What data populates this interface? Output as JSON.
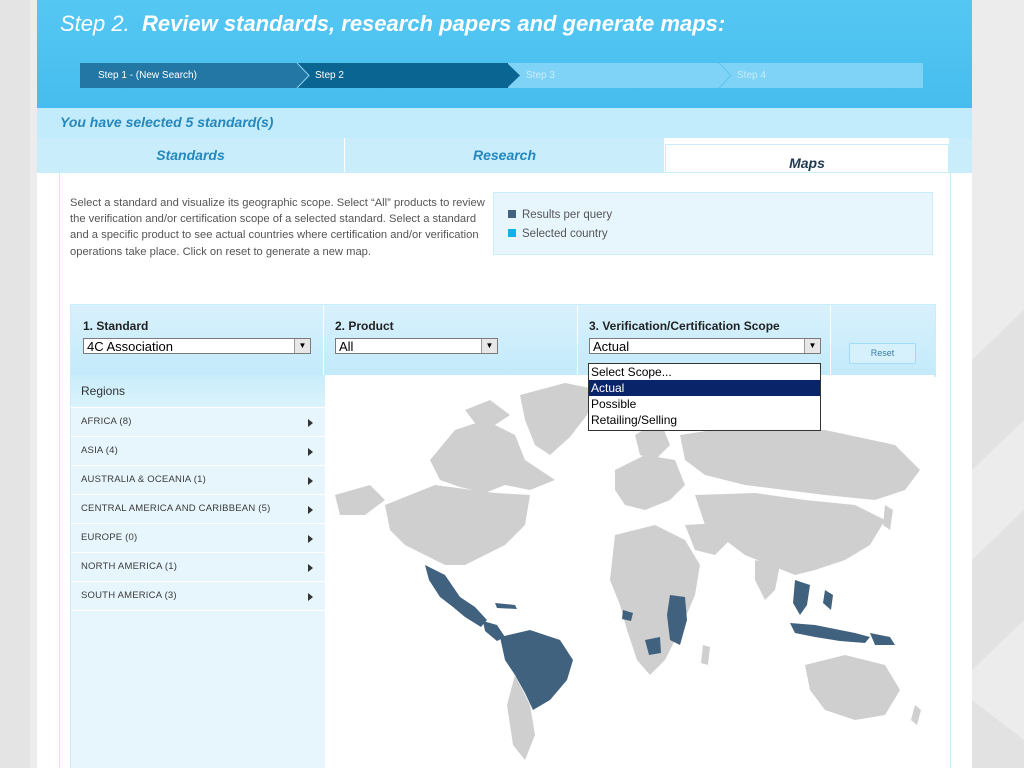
{
  "header": {
    "step_prefix": "Step 2.",
    "title": "Review standards, research papers and generate maps:"
  },
  "steps": [
    {
      "label": "Step 1 - (New Search)"
    },
    {
      "label": "Step 2"
    },
    {
      "label": "Step 3"
    },
    {
      "label": "Step 4"
    }
  ],
  "selected_text": "You have selected 5 standard(s)",
  "tabs": [
    {
      "label": "Standards"
    },
    {
      "label": "Research"
    },
    {
      "label": "Maps"
    }
  ],
  "description": "Select a standard and visualize its geographic scope. Select “All” products to review the verification and/or certification scope of a selected standard. Select a standard and a specific product to see actual countries where certification and/or verification operations take place. Click on reset to generate a new map.",
  "legend": {
    "items": [
      {
        "label": "Results per query",
        "color": "#41627f"
      },
      {
        "label": "Selected country",
        "color": "#13b0ea"
      }
    ]
  },
  "filters": {
    "standard": {
      "label": "1. Standard",
      "value": "4C Association"
    },
    "product": {
      "label": "2. Product",
      "value": "All"
    },
    "scope": {
      "label": "3. Verification/Certification Scope",
      "value": "Actual",
      "options": [
        "Select Scope...",
        "Actual",
        "Possible",
        "Retailing/Selling"
      ],
      "selected_index": 1
    },
    "reset_label": "Reset"
  },
  "sidebar": {
    "heading": "Regions",
    "regions": [
      {
        "label": "AFRICA (8)"
      },
      {
        "label": "ASIA (4)"
      },
      {
        "label": "AUSTRALIA & OCEANIA (1)"
      },
      {
        "label": "CENTRAL AMERICA AND CARIBBEAN (5)"
      },
      {
        "label": "EUROPE (0)"
      },
      {
        "label": "NORTH AMERICA (1)"
      },
      {
        "label": "SOUTH AMERICA (3)"
      }
    ]
  },
  "colors": {
    "header_blue": "#46bdee",
    "accent_text": "#2487bd",
    "map_land": "#cfcfcf",
    "map_highlight": "#41627f"
  }
}
